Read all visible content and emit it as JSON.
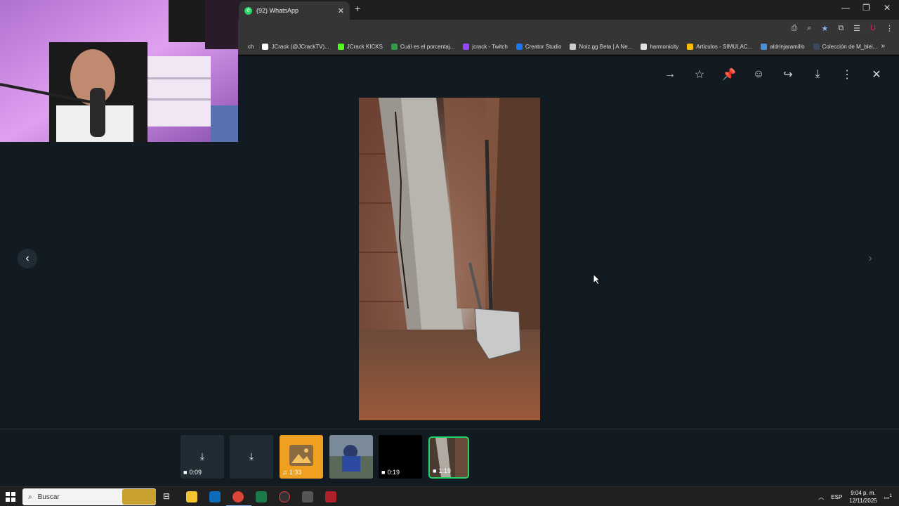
{
  "browser": {
    "tab_title": "(92) WhatsApp",
    "tab_close": "✕",
    "new_tab": "+",
    "bookmarks": [
      {
        "label": "ch",
        "icon": "cropped-icon",
        "color": "#353535"
      },
      {
        "label": "JCrack (@JCrackTV)...",
        "icon": "x-logo-icon",
        "color": "#ffffff"
      },
      {
        "label": "JCrack KICKS",
        "icon": "kick-icon",
        "color": "#53fc18"
      },
      {
        "label": "Cuál es el porcentaj...",
        "icon": "green-doc-icon",
        "color": "#2ea043"
      },
      {
        "label": "jcrack - Twitch",
        "icon": "twitch-icon",
        "color": "#9146ff"
      },
      {
        "label": "Creator Studio",
        "icon": "facebook-icon",
        "color": "#1877f2"
      },
      {
        "label": "Noiz.gg Beta | A Ne...",
        "icon": "noiz-icon",
        "color": "#cccccc"
      },
      {
        "label": "harmonicity",
        "icon": "harmonicity-icon",
        "color": "#e0e0e0"
      },
      {
        "label": "Articulos - SIMULAC...",
        "icon": "google-drive-icon",
        "color": "#fbbc04"
      },
      {
        "label": "aldrinjaramillo",
        "icon": "blue-tile-icon",
        "color": "#4a90d9"
      },
      {
        "label": "Colección de M_blei...",
        "icon": "dark-circle-icon",
        "color": "#3a4a5a"
      }
    ],
    "bookmarks_more": "»"
  },
  "viewer": {
    "actions": [
      {
        "name": "forward-arrow-icon",
        "glyph": "→"
      },
      {
        "name": "star-icon",
        "glyph": "☆"
      },
      {
        "name": "pin-icon",
        "glyph": "📌"
      },
      {
        "name": "emoji-icon",
        "glyph": "☺"
      },
      {
        "name": "share-icon",
        "glyph": "↪"
      },
      {
        "name": "download-icon",
        "glyph": "⤓"
      },
      {
        "name": "more-icon",
        "glyph": "⋮"
      },
      {
        "name": "close-icon",
        "glyph": "✕"
      }
    ],
    "prev": "‹",
    "next": "›"
  },
  "thumbnails": [
    {
      "kind": "video-download",
      "duration": "0:09"
    },
    {
      "kind": "download",
      "duration": ""
    },
    {
      "kind": "audio",
      "duration": "1:33"
    },
    {
      "kind": "image",
      "duration": ""
    },
    {
      "kind": "video-black",
      "duration": "0:19"
    },
    {
      "kind": "video-selected",
      "duration": "1:19"
    }
  ],
  "taskbar": {
    "search_placeholder": "Buscar",
    "lang": "ESP",
    "time": "9:04 p. m.",
    "date": "12/11/2025",
    "notifications": "1"
  }
}
